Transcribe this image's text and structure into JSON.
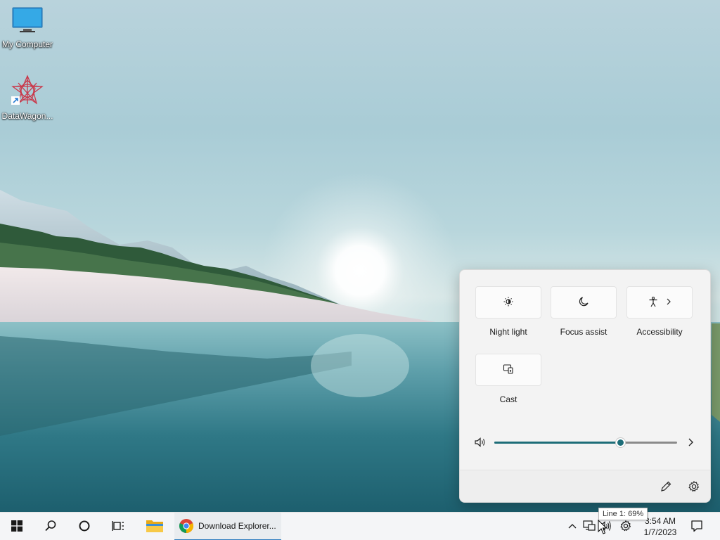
{
  "desktop": {
    "icons": [
      {
        "label": "My Computer",
        "icon": "computer-monitor-icon"
      },
      {
        "label": "DataWagon...",
        "icon": "datawagon-app-icon"
      }
    ]
  },
  "quick_settings": {
    "tiles": [
      {
        "label": "Night light",
        "icon": "brightness-icon"
      },
      {
        "label": "Focus assist",
        "icon": "moon-icon"
      },
      {
        "label": "Accessibility",
        "icon": "accessibility-icon",
        "has_chevron": true
      },
      {
        "label": "Cast",
        "icon": "cast-icon"
      }
    ],
    "volume": {
      "level_percent": 69,
      "icon": "speaker-icon"
    },
    "footer": {
      "edit_icon": "pencil-icon",
      "settings_icon": "gear-icon"
    }
  },
  "taskbar": {
    "start_icon": "windows-logo-icon",
    "search_icon": "search-icon",
    "cortana_icon": "circle-icon",
    "task_view_icon": "task-view-icon",
    "pinned_apps": [
      {
        "name": "File Explorer",
        "icon": "folder-icon"
      }
    ],
    "running_task": {
      "label": "Download Explorer...",
      "icon": "chrome-icon"
    },
    "tray": {
      "chevron_icon": "chevron-up-icon",
      "network_icon": "network-icon",
      "volume_icon": "speaker-icon",
      "settings_icon": "gear-icon"
    },
    "clock": {
      "time": "3:54 AM",
      "date": "1/7/2023"
    },
    "notification_icon": "notification-icon"
  },
  "tooltip": {
    "text": "Line 1: 69%"
  },
  "colors": {
    "accent": "#1d6d78",
    "taskbar_bg": "#f4f5f7",
    "panel_bg": "#f3f3f3"
  }
}
